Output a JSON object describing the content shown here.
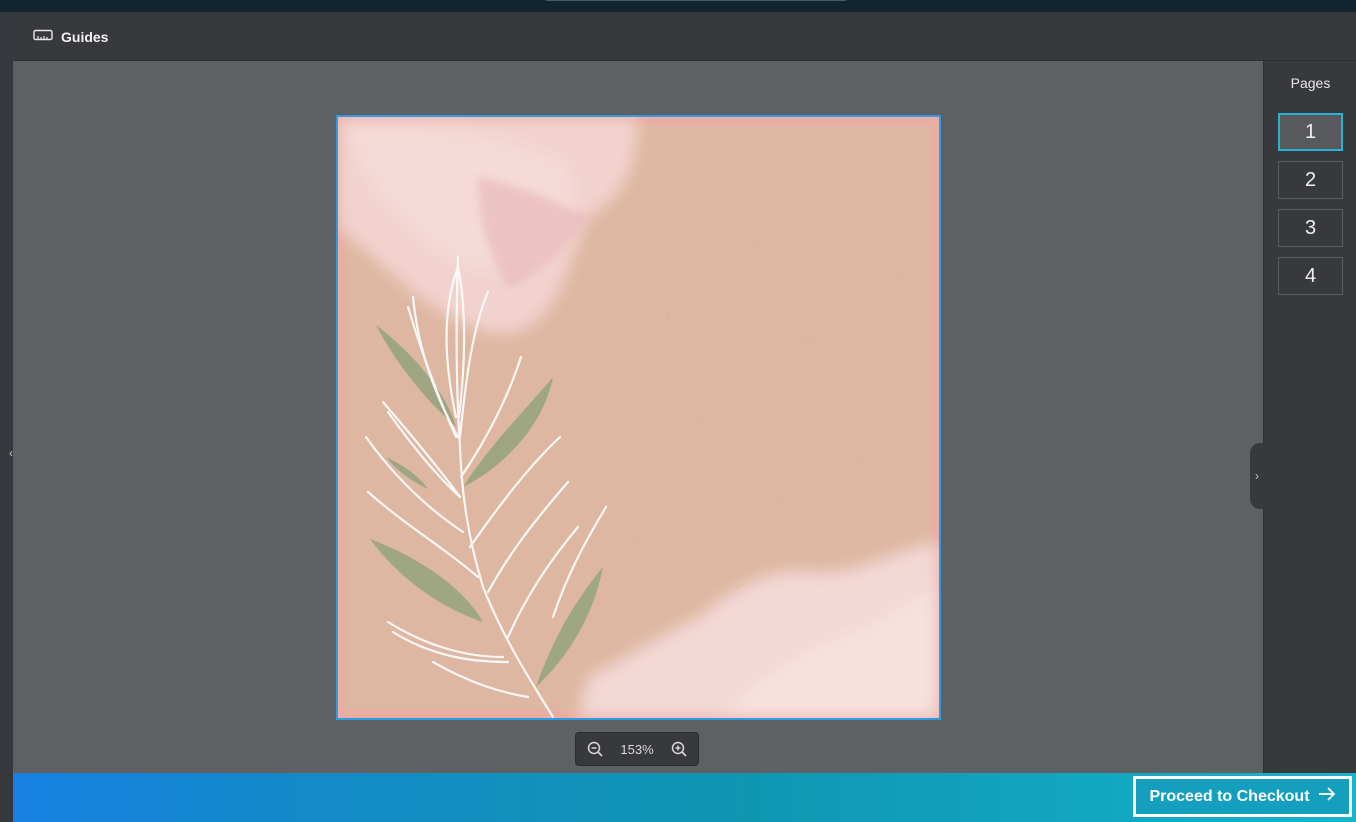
{
  "toolbar": {
    "guides_label": "Guides",
    "guides_icon": "ruler-icon"
  },
  "left_panel": {
    "toggle_glyph": "‹"
  },
  "right_panel": {
    "toggle_glyph": "›",
    "title": "Pages",
    "pages": [
      {
        "label": "1",
        "active": true
      },
      {
        "label": "2",
        "active": false
      },
      {
        "label": "3",
        "active": false
      },
      {
        "label": "4",
        "active": false
      }
    ]
  },
  "zoom": {
    "value": "153%",
    "zoom_out_icon": "zoom-out-icon",
    "zoom_in_icon": "zoom-in-icon"
  },
  "footer": {
    "checkout_label": "Proceed to Checkout",
    "checkout_icon": "arrow-right-icon"
  },
  "colors": {
    "accent": "#22b3d6",
    "artboard_border": "#2f9be3",
    "artboard_fill": "#ddb7a1",
    "footer_start": "#1780e2",
    "footer_end": "#18b3cc"
  }
}
